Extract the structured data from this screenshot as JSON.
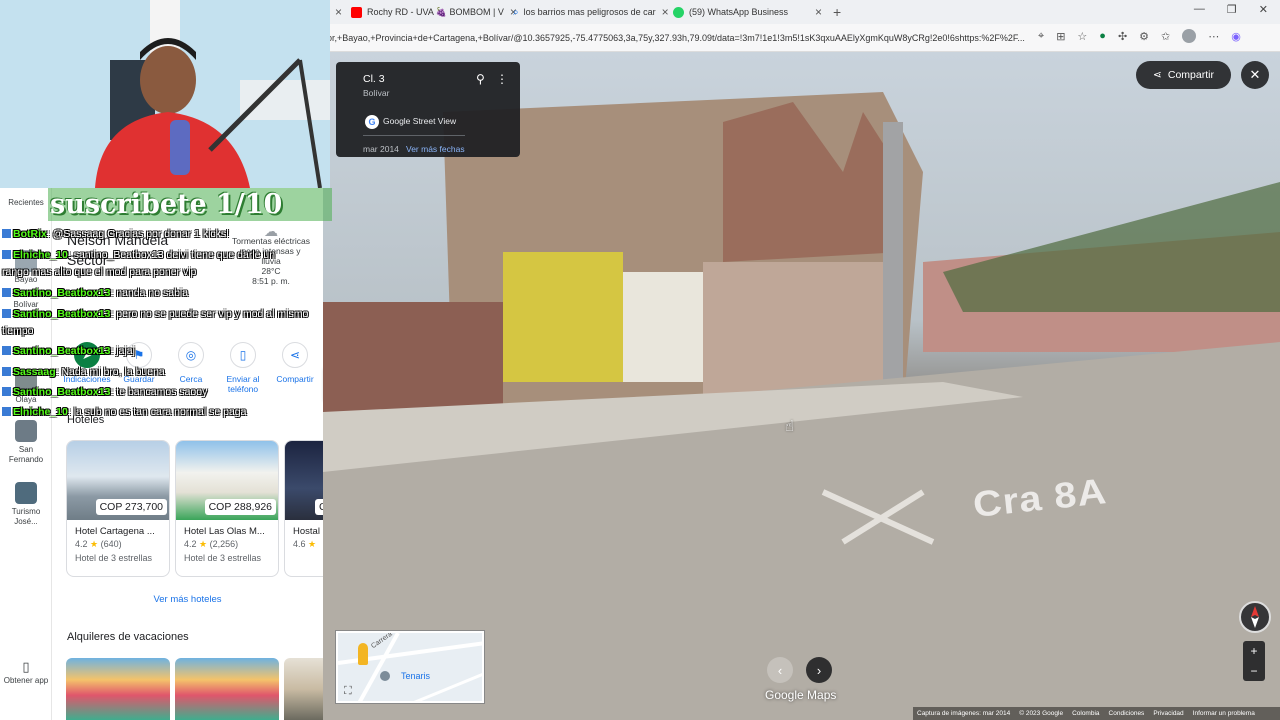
{
  "browser": {
    "tabs": [
      {
        "title": "Rochy RD - UVA 🍇 BOMBOM | V",
        "favicon_color": "#ff0000"
      },
      {
        "title": "los barrios mas peligrosos de car",
        "favicon_color": "#1a73e8"
      },
      {
        "title": "(59) WhatsApp Business",
        "favicon_color": "#25d366"
      }
    ],
    "new_tab_label": "+",
    "url": "or,+Bayao,+Provincia+de+Cartagena,+Bolívar/@10.3657925,-75.4775063,3a,75y,327.93h,79.09t/data=!3m7!1e1!3m5!1sK3qxuAAElyXgmKquW8yCRg!2e0!6shttps:%2F%2F..."
  },
  "stream": {
    "banner_text": "suscribete 1/10",
    "chat": [
      {
        "user": "BotRix",
        "text": ": @Sassaag Gracias por donar 1 kicks!"
      },
      {
        "user": "Elniche_10",
        "text": ": santino_Beatbox13 deivi tiene que darle un"
      },
      {
        "user": "",
        "text": "rango mas alto que el mod para poner vip"
      },
      {
        "user": "Santino_Beatbox13",
        "text": ": nanda no sabia"
      },
      {
        "user": "Santino_Beatbox13",
        "text": ": pero no se puede ser vip y mod al mismo"
      },
      {
        "user": "",
        "text": "tiempo"
      },
      {
        "user": "Santino_Beatbox13",
        "text": ": jajaj"
      },
      {
        "user": "Sassaag",
        "text": ": Nada mi bro, la buena"
      },
      {
        "user": "Santino_Beatbox13",
        "text": ": te bancamos saooy"
      },
      {
        "user": "Elniche_10",
        "text": ": la sub no es tan cara normal se paga"
      }
    ]
  },
  "maps_panel": {
    "rail": [
      {
        "label": "Recientes"
      },
      {
        "label": "Bayao"
      },
      {
        "label": "Bolívar"
      },
      {
        "label": "Olaya"
      },
      {
        "label": "San Fernando"
      },
      {
        "label": "Turismo José..."
      }
    ],
    "get_app_label": "Obtener app",
    "title": "Nelson Mandela",
    "subtitle": "Sector",
    "weather": {
      "text": "Tormentas eléctricas poco intensas y lluvia",
      "temp": "28°C",
      "time": "8:51 p. m."
    },
    "actions": [
      {
        "label": "Indicaciones",
        "icon": "directions-icon"
      },
      {
        "label": "Guardar",
        "icon": "bookmark-icon"
      },
      {
        "label": "Cerca",
        "icon": "nearby-icon"
      },
      {
        "label": "Enviar al teléfono",
        "icon": "send-to-phone-icon"
      },
      {
        "label": "Compartir",
        "icon": "share-icon"
      }
    ],
    "hotels_heading": "Hoteles",
    "hotels": [
      {
        "name": "Hotel Cartagena ...",
        "price": "COP 273,700",
        "rating": "4.2",
        "reviews": "(640)",
        "class": "Hotel de 3 estrellas"
      },
      {
        "name": "Hotel Las Olas M...",
        "price": "COP 288,926",
        "rating": "4.2",
        "reviews": "(2,256)",
        "class": "Hotel de 3 estrellas"
      },
      {
        "name": "Hostal",
        "price": "C",
        "rating": "4.6",
        "reviews": "",
        "class": ""
      }
    ],
    "more_hotels": "Ver más hoteles",
    "vacation_heading": "Alquileres de vacaciones"
  },
  "street_view": {
    "street": "Cl. 3",
    "region": "Bolívar",
    "provider": "Google Street View",
    "capture_date": "mar 2014",
    "more_dates": "Ver más fechas",
    "share_label": "Compartir",
    "minimap_label": "Tenaris",
    "minimap_street": "Carrera",
    "logo": "Google Maps",
    "road_marking": "Cra 8A",
    "footer": [
      "Captura de imágenes: mar 2014",
      "© 2023 Google",
      "Colombia",
      "Condiciones",
      "Privacidad",
      "Informar un problema"
    ]
  }
}
